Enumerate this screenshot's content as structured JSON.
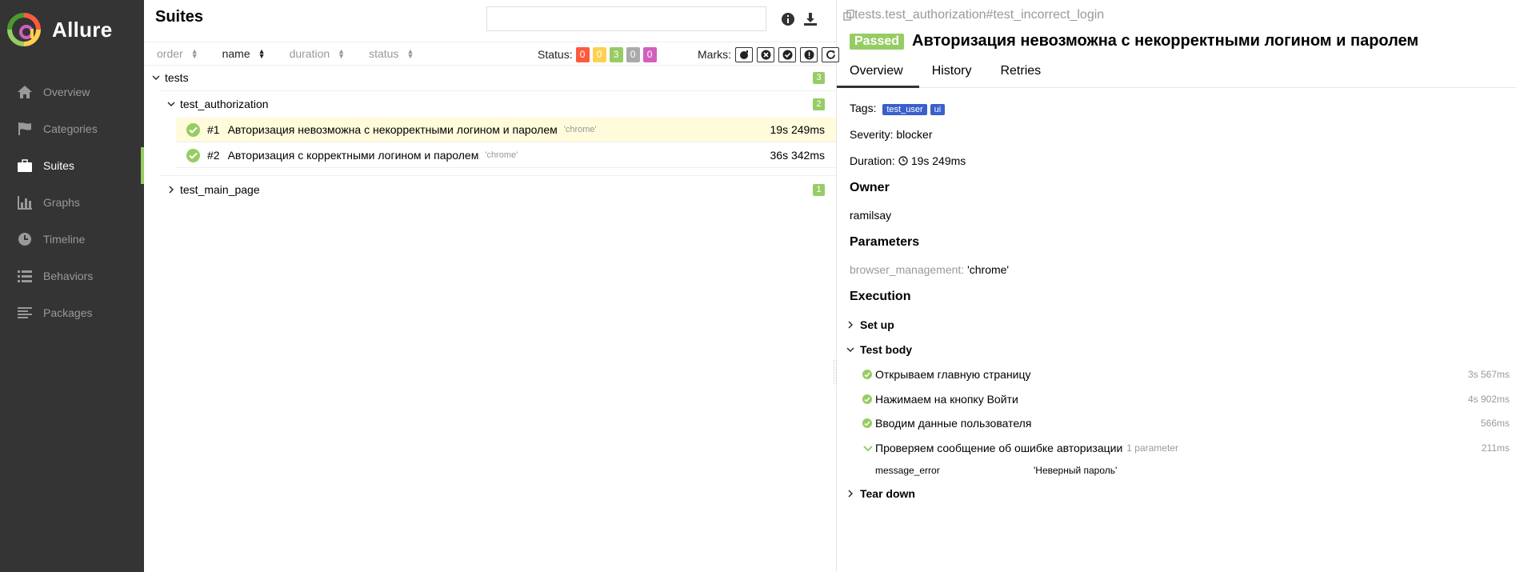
{
  "app": {
    "name": "Allure"
  },
  "sidebar": {
    "items": [
      {
        "label": "Overview",
        "icon": "home-icon"
      },
      {
        "label": "Categories",
        "icon": "flag-icon"
      },
      {
        "label": "Suites",
        "icon": "briefcase-icon",
        "active": true
      },
      {
        "label": "Graphs",
        "icon": "bar-chart-icon"
      },
      {
        "label": "Timeline",
        "icon": "clock-icon"
      },
      {
        "label": "Behaviors",
        "icon": "list-icon"
      },
      {
        "label": "Packages",
        "icon": "align-left-icon"
      }
    ]
  },
  "suites": {
    "title": "Suites",
    "search": {
      "value": "",
      "placeholder": ""
    },
    "sort": {
      "order": "order",
      "name": "name",
      "duration": "duration",
      "status": "status"
    },
    "status_label": "Status:",
    "status_counts": [
      {
        "value": "0",
        "color": "#fd5a3e"
      },
      {
        "value": "0",
        "color": "#ffd050"
      },
      {
        "value": "3",
        "color": "#97cc64"
      },
      {
        "value": "0",
        "color": "#aaaaaa"
      },
      {
        "value": "0",
        "color": "#d35ebe"
      }
    ],
    "marks_label": "Marks:",
    "tree": {
      "root": {
        "label": "tests",
        "count": "3"
      },
      "group1": {
        "label": "test_authorization",
        "count": "2"
      },
      "tests": [
        {
          "num": "#1",
          "name": "Авторизация невозможна с некорректными логином и паролем",
          "param": "'chrome'",
          "duration": "19s 249ms"
        },
        {
          "num": "#2",
          "name": "Авторизация с корректными логином и паролем",
          "param": "'chrome'",
          "duration": "36s 342ms"
        }
      ],
      "group2": {
        "label": "test_main_page",
        "count": "1"
      }
    }
  },
  "detail": {
    "path": "tests.test_authorization#test_incorrect_login",
    "status": "Passed",
    "title": "Авторизация невозможна с некорректными логином и паролем",
    "tabs": [
      "Overview",
      "History",
      "Retries"
    ],
    "tags_label": "Tags:",
    "tags": [
      "test_user",
      "ui"
    ],
    "severity": "Severity: blocker",
    "duration_label": "Duration:",
    "duration": "19s 249ms",
    "owner_heading": "Owner",
    "owner": "ramilsay",
    "params_heading": "Parameters",
    "param_name": "browser_management:",
    "param_value": "'chrome'",
    "execution_heading": "Execution",
    "setup": "Set up",
    "test_body": "Test body",
    "steps": [
      {
        "label": "Открываем главную страницу",
        "duration": "3s 567ms"
      },
      {
        "label": "Нажимаем на кнопку Войти",
        "duration": "4s 902ms"
      },
      {
        "label": "Вводим данные пользователя",
        "duration": "566ms"
      },
      {
        "label": "Проверяем сообщение об ошибке авторизации",
        "extra": "1 parameter",
        "duration": "211ms"
      }
    ],
    "step_param": {
      "name": "message_error",
      "value": "'Неверный пароль'"
    },
    "teardown": "Tear down"
  },
  "colors": {
    "sidebar_bg": "#343434",
    "passed": "#97cc64",
    "accent": "#5aa0e6",
    "tag": "#3a5fcd",
    "selected_row": "#fffbdb"
  }
}
